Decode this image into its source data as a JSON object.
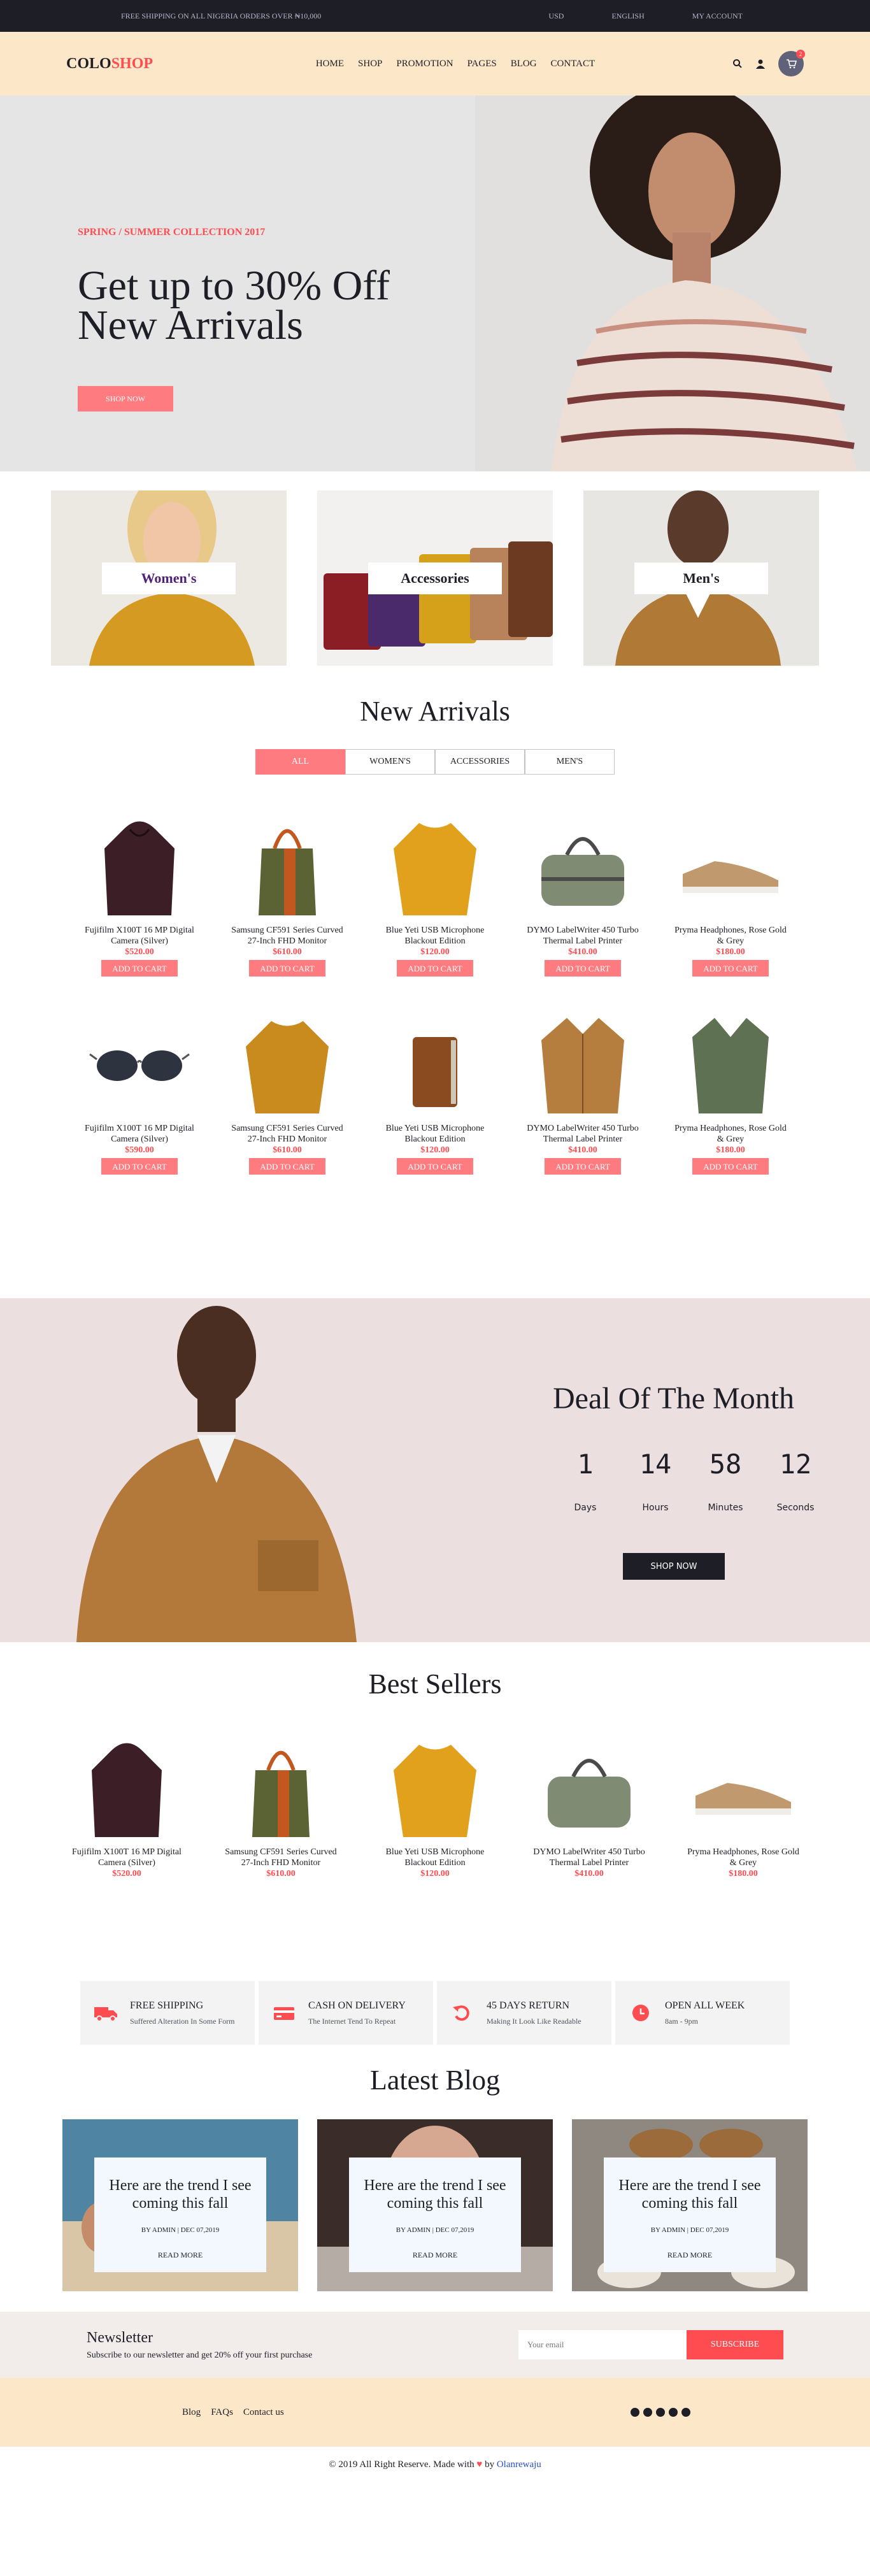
{
  "topbar": {
    "shipping": "FREE SHIPPING ON ALL NIGERIA ORDERS OVER ₦10,000",
    "currency": "USD",
    "language": "ENGLISH",
    "account": "MY ACCOUNT"
  },
  "navbar": {
    "logo_a": "COLO",
    "logo_b": "SHOP",
    "menu": [
      "HOME",
      "SHOP",
      "PROMOTION",
      "PAGES",
      "BLOG",
      "CONTACT"
    ],
    "cart_count": "2"
  },
  "hero": {
    "subtitle": "SPRING / SUMMER COLLECTION 2017",
    "title_line1": "Get up to 30% Off",
    "title_line2": "New Arrivals",
    "button": "SHOP NOW"
  },
  "banners": [
    "Women's",
    "Accessories",
    "Men's"
  ],
  "arrivals": {
    "title": "New Arrivals",
    "tabs": [
      "ALL",
      "WOMEN'S",
      "ACCESSORIES",
      "MEN'S"
    ],
    "row1": [
      {
        "name": "Fujifilm X100T 16 MP Digital Camera (Silver)",
        "price": "$520.00",
        "icon": "hoodie",
        "button": "ADD TO CART"
      },
      {
        "name": "Samsung CF591 Series Curved 27-Inch FHD Monitor",
        "price": "$610.00",
        "icon": "bucket-bag",
        "button": "ADD TO CART"
      },
      {
        "name": "Blue Yeti USB Microphone Blackout Edition",
        "price": "$120.00",
        "icon": "sweater",
        "button": "ADD TO CART"
      },
      {
        "name": "DYMO LabelWriter 450 Turbo Thermal Label Printer",
        "price": "$410.00",
        "icon": "duffel-bag",
        "button": "ADD TO CART"
      },
      {
        "name": "Pryma Headphones, Rose Gold & Grey",
        "price": "$180.00",
        "icon": "sneaker",
        "button": "ADD TO CART"
      }
    ],
    "row2": [
      {
        "name": "Fujifilm X100T 16 MP Digital Camera (Silver)",
        "price": "$590.00",
        "icon": "sunglasses",
        "button": "ADD TO CART"
      },
      {
        "name": "Samsung CF591 Series Curved 27-Inch FHD Monitor",
        "price": "$610.00",
        "icon": "sweater",
        "button": "ADD TO CART"
      },
      {
        "name": "Blue Yeti USB Microphone Blackout Edition",
        "price": "$120.00",
        "icon": "wallet",
        "button": "ADD TO CART"
      },
      {
        "name": "DYMO LabelWriter 450 Turbo Thermal Label Printer",
        "price": "$410.00",
        "icon": "jacket",
        "button": "ADD TO CART"
      },
      {
        "name": "Pryma Headphones, Rose Gold & Grey",
        "price": "$180.00",
        "icon": "cardigan",
        "button": "ADD TO CART"
      }
    ]
  },
  "deal": {
    "title": "Deal Of The Month",
    "timer": [
      {
        "n": "1",
        "u": "Days"
      },
      {
        "n": "14",
        "u": "Hours"
      },
      {
        "n": "58",
        "u": "Minutes"
      },
      {
        "n": "12",
        "u": "Seconds"
      }
    ],
    "button": "SHOP NOW"
  },
  "bestsellers": {
    "title": "Best Sellers",
    "items": [
      {
        "name": "Fujifilm X100T 16 MP Digital Camera (Silver)",
        "price": "$520.00"
      },
      {
        "name": "Samsung CF591 Series Curved 27-Inch FHD Monitor",
        "price": "$610.00"
      },
      {
        "name": "Blue Yeti USB Microphone Blackout Edition",
        "price": "$120.00"
      },
      {
        "name": "DYMO LabelWriter 450 Turbo Thermal Label Printer",
        "price": "$410.00"
      },
      {
        "name": "Pryma Headphones, Rose Gold & Grey",
        "price": "$180.00"
      }
    ]
  },
  "benefits": [
    {
      "title": "FREE SHIPPING",
      "text": "Suffered Alteration In Some Form",
      "icon": "truck-icon"
    },
    {
      "title": "CASH ON DELIVERY",
      "text": "The Internet Tend To Repeat",
      "icon": "card-icon"
    },
    {
      "title": "45 DAYS RETURN",
      "text": "Making It Look Like Readable",
      "icon": "return-icon"
    },
    {
      "title": "OPEN ALL WEEK",
      "text": "8am - 9pm",
      "icon": "clock-icon"
    }
  ],
  "blog": {
    "title": "Latest Blog",
    "posts": [
      {
        "title": "Here are the trend I see coming this fall",
        "meta": "BY ADMIN | DEC 07,2019",
        "read": "READ MORE"
      },
      {
        "title": "Here are the trend I see coming this fall",
        "meta": "BY ADMIN | DEC 07,2019",
        "read": "READ MORE"
      },
      {
        "title": "Here are the trend I see coming this fall",
        "meta": "BY ADMIN | DEC 07,2019",
        "read": "READ MORE"
      }
    ]
  },
  "newsletter": {
    "title": "Newsletter",
    "text": "Subscribe to our newsletter and get 20% off your first purchase",
    "placeholder": "Your email",
    "button": "SUBSCRIBE"
  },
  "footer": {
    "links": [
      "Blog",
      "FAQs",
      "Contact us"
    ],
    "copyright_pre": "© 2019 All Right Reserve. Made with",
    "heart": "♥",
    "by": "by",
    "author": "Olanrewaju"
  },
  "colors": {
    "accent": "#fe4c50",
    "button": "#fe7c7f",
    "dark": "#1e1e27",
    "cream": "#fde7c9",
    "deal_bg": "#ebdfe0"
  }
}
